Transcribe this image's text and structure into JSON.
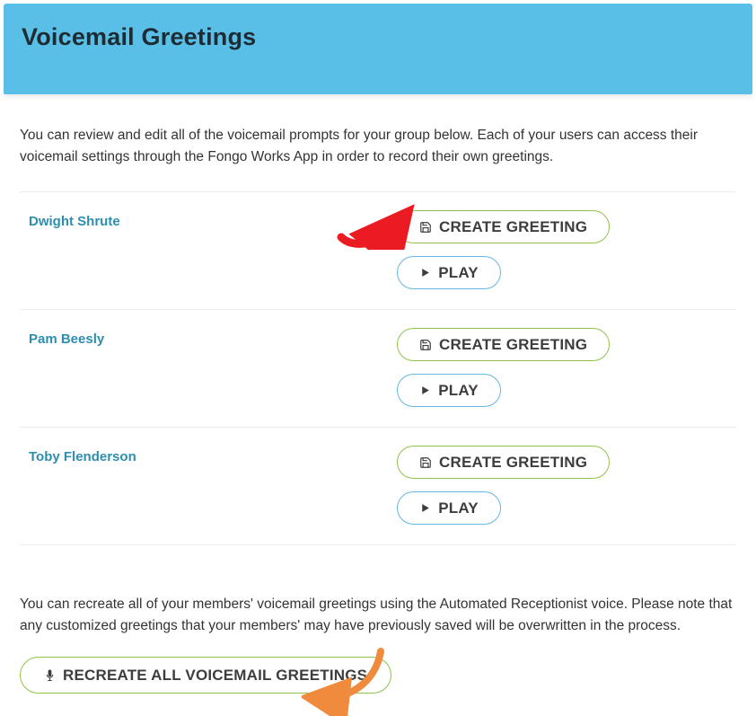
{
  "header": {
    "title": "Voicemail Greetings"
  },
  "intro": "You can review and edit all of the voicemail prompts for your group below. Each of your users can access their voicemail settings through the Fongo Works App in order to record their own greetings.",
  "buttons": {
    "create": "CREATE GREETING",
    "play": "PLAY",
    "recreate_all": "RECREATE ALL VOICEMAIL GREETINGS"
  },
  "users": [
    {
      "name": "Dwight Shrute"
    },
    {
      "name": "Pam Beesly"
    },
    {
      "name": "Toby Flenderson"
    }
  ],
  "footer_text": "You can recreate all of your members' voicemail greetings using the Automated Receptionist voice. Please note that any customized greetings that your members' may have previously saved will be overwritten in the process."
}
